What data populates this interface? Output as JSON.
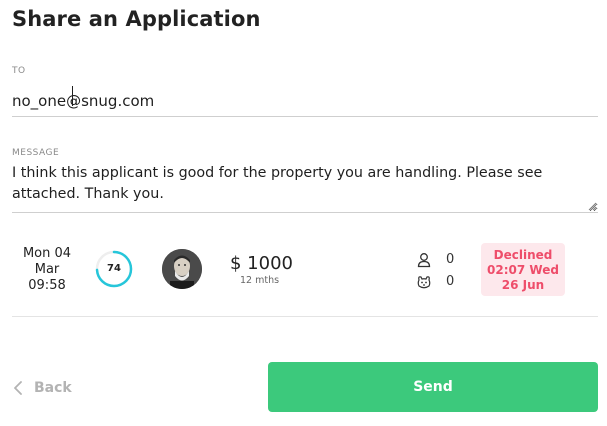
{
  "dialog": {
    "title": "Share an Application"
  },
  "to": {
    "label": "TO",
    "value": "no_one@snug.com"
  },
  "message": {
    "label": "MESSAGE",
    "value": "I think this applicant is good for the property you are handling. Please see attached. Thank you."
  },
  "application": {
    "date_line1": "Mon 04",
    "date_line2": "Mar",
    "time": "09:58",
    "score": "74",
    "score_fraction": 0.74,
    "score_color": "#26c6da",
    "rent": "$ 1000",
    "term": "12 mths",
    "people_count": "0",
    "pets_count": "0",
    "people_icon": "person-icon",
    "pets_icon": "pet-icon",
    "status_line1": "Declined",
    "status_line2": "02:07 Wed",
    "status_line3": "26 Jun",
    "status_color": "#ee4d6a"
  },
  "actions": {
    "back_label": "Back",
    "send_label": "Send",
    "send_color": "#3cc97c"
  }
}
